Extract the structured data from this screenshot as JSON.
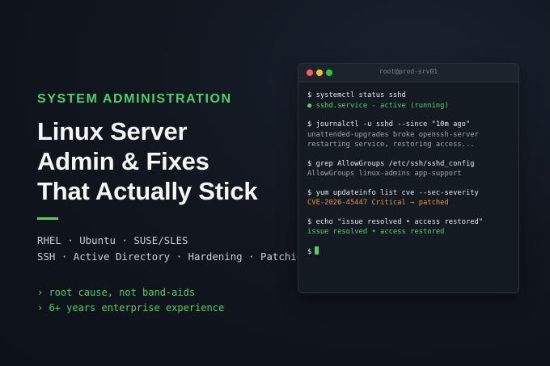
{
  "hero": {
    "kicker": "SYSTEM ADMINISTRATION",
    "title_lines": [
      "Linux Server",
      "Admin & Fixes",
      "That Actually Stick"
    ],
    "tags_line1": "RHEL · Ubuntu · SUSE/SLES",
    "tags_line2": "SSH · Active Directory · Hardening · Patching",
    "bullets": [
      "› root cause, not band-aids",
      "› 6+ years enterprise experience"
    ]
  },
  "terminal": {
    "title": "root@prod-srv01",
    "prompt": "$",
    "blocks": [
      {
        "command": "systemctl status sshd",
        "output": [
          {
            "text": "● sshd.service - active (running)",
            "style": "ok"
          }
        ]
      },
      {
        "command": "journalctl -u sshd --since \"10m ago\"",
        "output": [
          {
            "text": "unattended-upgrades broke openssh-server",
            "style": "muted"
          },
          {
            "text": "restarting service, restoring access...",
            "style": "muted"
          }
        ]
      },
      {
        "command": "grep AllowGroups /etc/ssh/sshd_config",
        "output": [
          {
            "text": "AllowGroups linux-admins app-support",
            "style": "muted"
          }
        ]
      },
      {
        "command": "yum updateinfo list cve --sec-severity",
        "output": [
          {
            "text": "CVE-2026-45447 Critical → patched",
            "style": "warn"
          }
        ]
      },
      {
        "command": "echo \"issue resolved • access restored\"",
        "output": [
          {
            "text": "issue resolved • access restored",
            "style": "ok"
          }
        ]
      }
    ]
  },
  "colors": {
    "accent": "#4fd06a",
    "warn": "#e8923c",
    "background": "#11161f"
  }
}
